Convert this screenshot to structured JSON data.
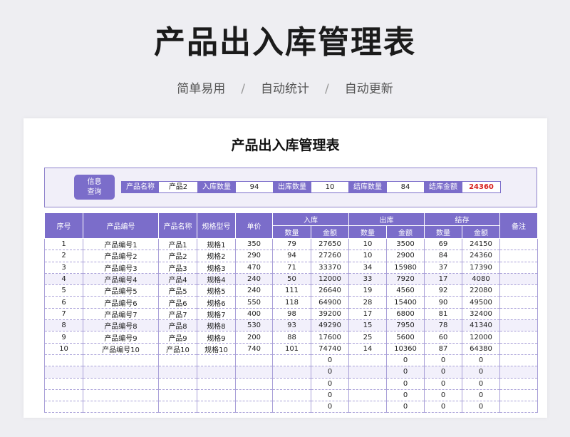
{
  "hero": {
    "title": "产品出入库管理表",
    "tags": [
      "简单易用",
      "自动统计",
      "自动更新"
    ],
    "separator": "/"
  },
  "sheet": {
    "title": "产品出入库管理表",
    "query": {
      "button_label": "信息\n查询",
      "fields": [
        {
          "label": "产品名称",
          "value": "产品2"
        },
        {
          "label": "入库数量",
          "value": "94"
        },
        {
          "label": "出库数量",
          "value": "10"
        },
        {
          "label": "结库数量",
          "value": "84"
        },
        {
          "label": "结库金额",
          "value": "24360"
        }
      ]
    },
    "headers": {
      "seq": "序号",
      "product_code": "产品编号",
      "product_name": "产品名称",
      "spec": "规格型号",
      "price": "单价",
      "in_group": "入库",
      "out_group": "出库",
      "stock_group": "结存",
      "qty": "数量",
      "amount": "金额",
      "remark": "备注"
    },
    "rows": [
      [
        "1",
        "产品编号1",
        "产品1",
        "规格1",
        "350",
        "79",
        "27650",
        "10",
        "3500",
        "69",
        "24150",
        ""
      ],
      [
        "2",
        "产品编号2",
        "产品2",
        "规格2",
        "290",
        "94",
        "27260",
        "10",
        "2900",
        "84",
        "24360",
        ""
      ],
      [
        "3",
        "产品编号3",
        "产品3",
        "规格3",
        "470",
        "71",
        "33370",
        "34",
        "15980",
        "37",
        "17390",
        ""
      ],
      [
        "4",
        "产品编号4",
        "产品4",
        "规格4",
        "240",
        "50",
        "12000",
        "33",
        "7920",
        "17",
        "4080",
        ""
      ],
      [
        "5",
        "产品编号5",
        "产品5",
        "规格5",
        "240",
        "111",
        "26640",
        "19",
        "4560",
        "92",
        "22080",
        ""
      ],
      [
        "6",
        "产品编号6",
        "产品6",
        "规格6",
        "550",
        "118",
        "64900",
        "28",
        "15400",
        "90",
        "49500",
        ""
      ],
      [
        "7",
        "产品编号7",
        "产品7",
        "规格7",
        "400",
        "98",
        "39200",
        "17",
        "6800",
        "81",
        "32400",
        ""
      ],
      [
        "8",
        "产品编号8",
        "产品8",
        "规格8",
        "530",
        "93",
        "49290",
        "15",
        "7950",
        "78",
        "41340",
        ""
      ],
      [
        "9",
        "产品编号9",
        "产品9",
        "规格9",
        "200",
        "88",
        "17600",
        "25",
        "5600",
        "60",
        "12000",
        ""
      ],
      [
        "10",
        "产品编号10",
        "产品10",
        "规格10",
        "740",
        "101",
        "74740",
        "14",
        "10360",
        "87",
        "64380",
        ""
      ],
      [
        "",
        "",
        "",
        "",
        "",
        "",
        "0",
        "",
        "0",
        "0",
        "0",
        ""
      ],
      [
        "",
        "",
        "",
        "",
        "",
        "",
        "0",
        "",
        "0",
        "0",
        "0",
        ""
      ],
      [
        "",
        "",
        "",
        "",
        "",
        "",
        "0",
        "",
        "0",
        "0",
        "0",
        ""
      ],
      [
        "",
        "",
        "",
        "",
        "",
        "",
        "0",
        "",
        "0",
        "0",
        "0",
        ""
      ],
      [
        "",
        "",
        "",
        "",
        "",
        "",
        "0",
        "",
        "0",
        "0",
        "0",
        ""
      ]
    ]
  },
  "colors": {
    "accent": "#7b6dca",
    "alt_row": "#f2f0fb",
    "highlight_value": "#d8201e"
  }
}
